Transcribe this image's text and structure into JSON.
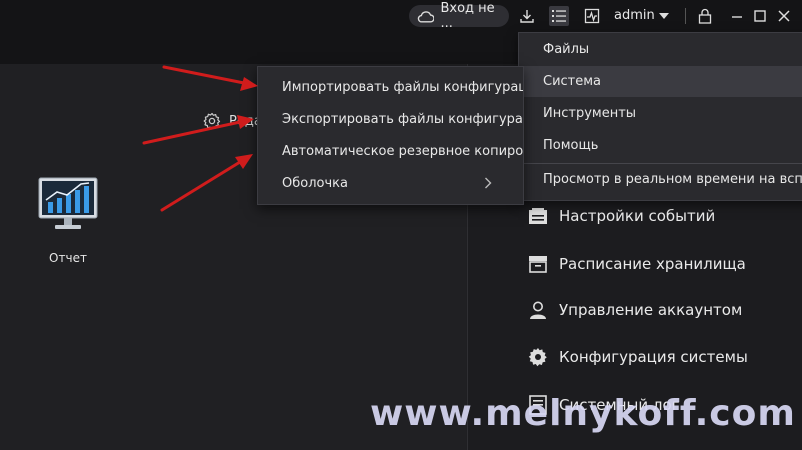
{
  "topbar": {
    "login_label": "Вход не ...",
    "user": "admin"
  },
  "left": {
    "edit_label": "Реда",
    "report_label": "Отчет"
  },
  "system_menu": {
    "items": [
      "Файлы",
      "Система",
      "Инструменты",
      "Помощь",
      "Просмотр в реальном времени на вспомо"
    ]
  },
  "system_submenu": {
    "items": [
      "Импортировать файлы конфигурации",
      "Экспортировать файлы конфигурации",
      "Автоматическое резервное копирован",
      "Оболочка"
    ]
  },
  "right_panel": {
    "items": [
      "Настройки событий",
      "Расписание хранилища",
      "Управление аккаунтом",
      "Конфигурация системы",
      "Системный лог"
    ]
  },
  "watermark": "www.melnykoff.com",
  "colors": {
    "arrow": "#d01c1c",
    "chart_blue": "#3a9be8",
    "menu_bg": "#2a2a2e"
  }
}
